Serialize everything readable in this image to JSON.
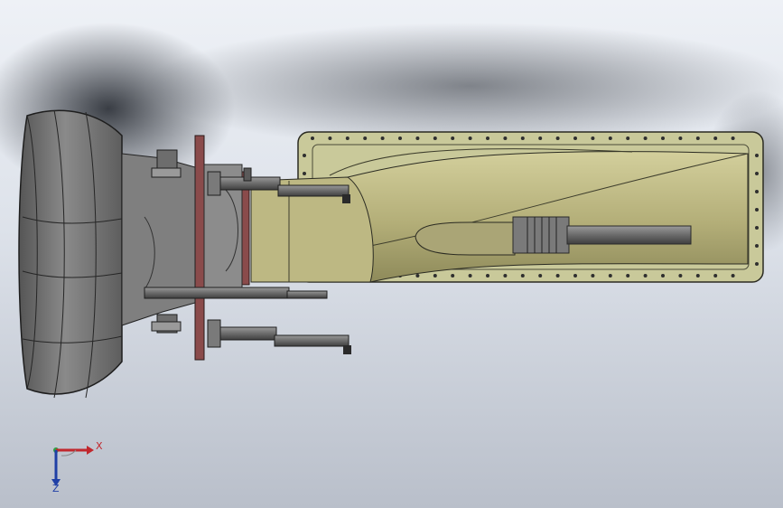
{
  "viewport": {
    "background_top": "#eef1f6",
    "background_bottom": "#b9bfca"
  },
  "model": {
    "housing_color": "#c9c99a",
    "housing_edge": "#2b2b22",
    "nozzle_color": "#b7b27f",
    "body_color": "#7d7d7d",
    "body_dark": "#4a4a4a",
    "flange_color": "#8a4b4b",
    "bolt_color": "#2f2f2f"
  },
  "triad": {
    "x_label": "X",
    "z_label": "Z",
    "x_color": "#c1272d",
    "y_color": "#2e9e44",
    "z_color": "#1f3fa6"
  }
}
